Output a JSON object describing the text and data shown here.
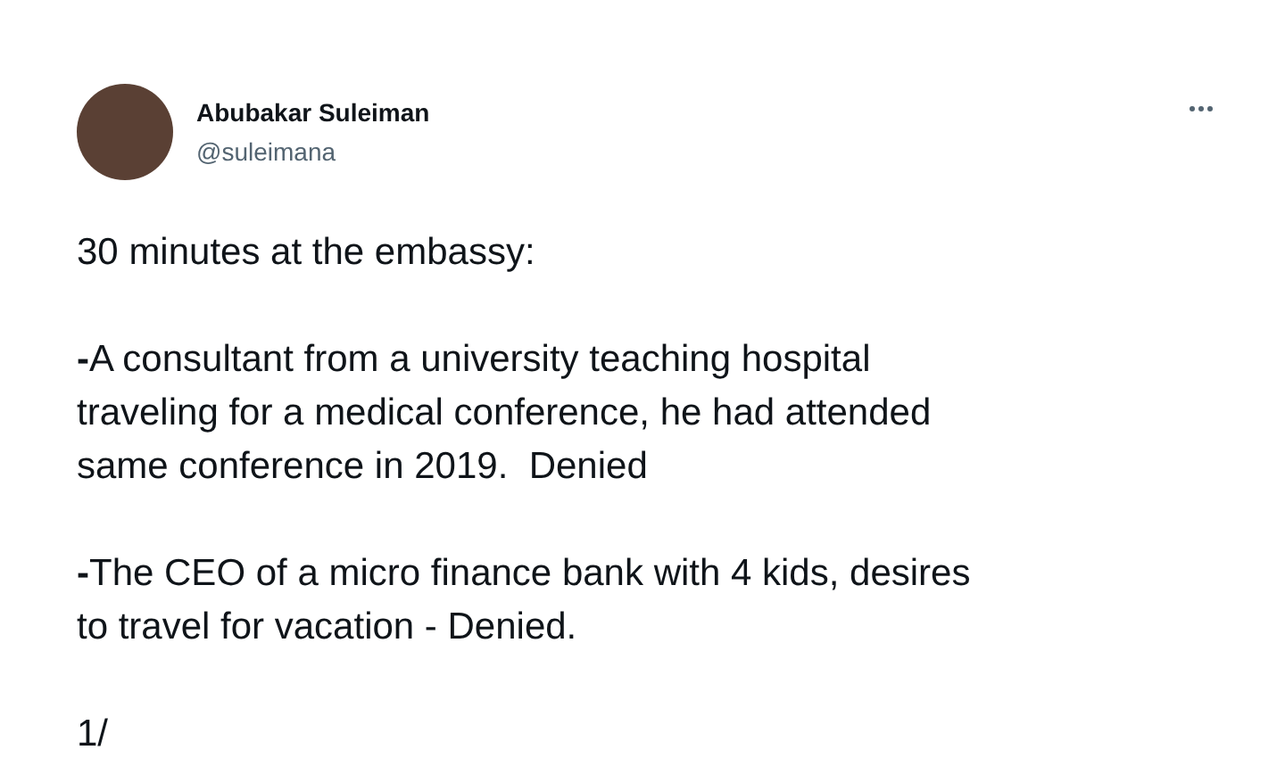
{
  "author": {
    "name": "Abubakar Suleiman",
    "handle": "@suleimana"
  },
  "paragraphs": [
    {
      "lines": [
        "30 minutes at the embassy:"
      ]
    },
    {
      "lines": [
        "**-**A consultant from a university teaching hospital",
        "traveling for a medical conference, he had attended",
        "same conference in 2019.  Denied"
      ]
    },
    {
      "lines": [
        "**-**The CEO of a micro finance bank with 4 kids, desires",
        "to travel for vacation - Denied."
      ]
    },
    {
      "lines": [
        "1/"
      ]
    }
  ]
}
